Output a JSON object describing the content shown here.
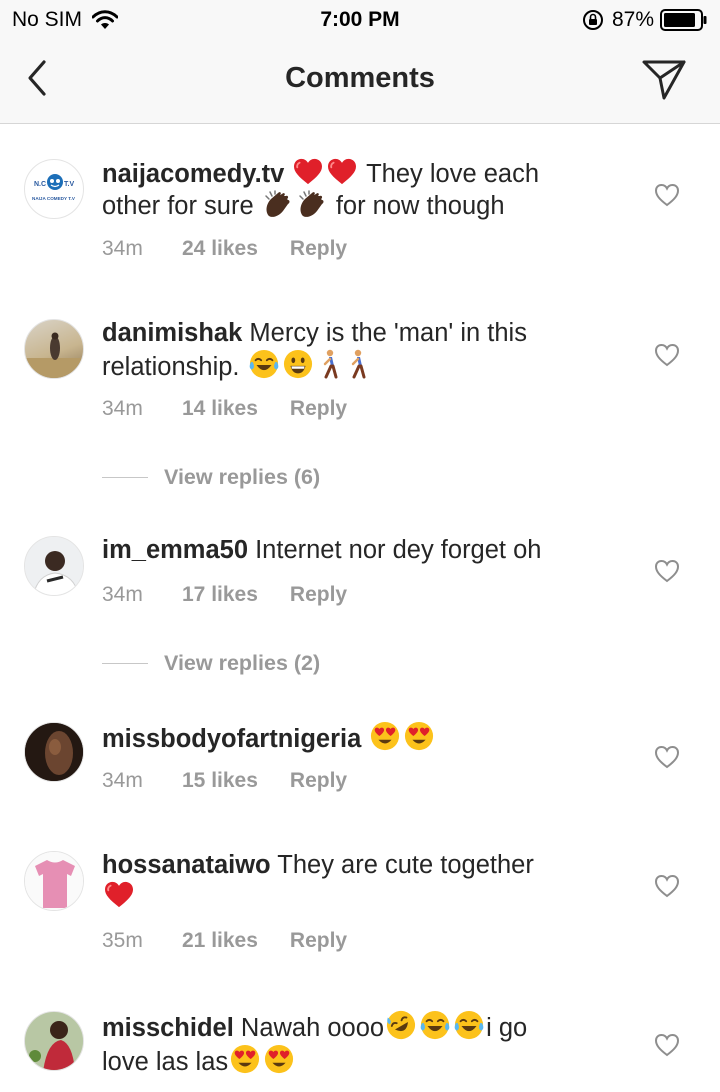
{
  "status_bar": {
    "carrier": "No SIM",
    "time": "7:00 PM",
    "battery": "87%"
  },
  "nav": {
    "title": "Comments"
  },
  "comments": [
    {
      "username": "naijacomedy.tv",
      "text_a": " They love each other for sure ",
      "text_b": " for now though",
      "time": "34m",
      "likes": "24 likes",
      "reply": "Reply",
      "avatar_text": [
        "N.C",
        "T.V",
        "NAIJA COMEDY T.V"
      ]
    },
    {
      "username": "danimishak",
      "text": " Mercy is the 'man' in this relationship. ",
      "time": "34m",
      "likes": "14 likes",
      "reply": "Reply",
      "view_replies": "View replies (6)"
    },
    {
      "username": "im_emma50",
      "text": " Internet nor dey forget oh",
      "time": "34m",
      "likes": "17 likes",
      "reply": "Reply",
      "view_replies": "View replies (2)"
    },
    {
      "username": "missbodyofartnigeria",
      "text": " ",
      "time": "34m",
      "likes": "15 likes",
      "reply": "Reply"
    },
    {
      "username": "hossanataiwo",
      "text": " They are cute together",
      "time": "35m",
      "likes": "21 likes",
      "reply": "Reply"
    },
    {
      "username": "misschidel",
      "text_a": " Nawah oooo",
      "text_b": "i go love las las"
    }
  ],
  "colors": {
    "text": "#262626",
    "muted": "#999999",
    "heart_red": "#e0202a",
    "bar_bg": "#f8f8f8"
  }
}
